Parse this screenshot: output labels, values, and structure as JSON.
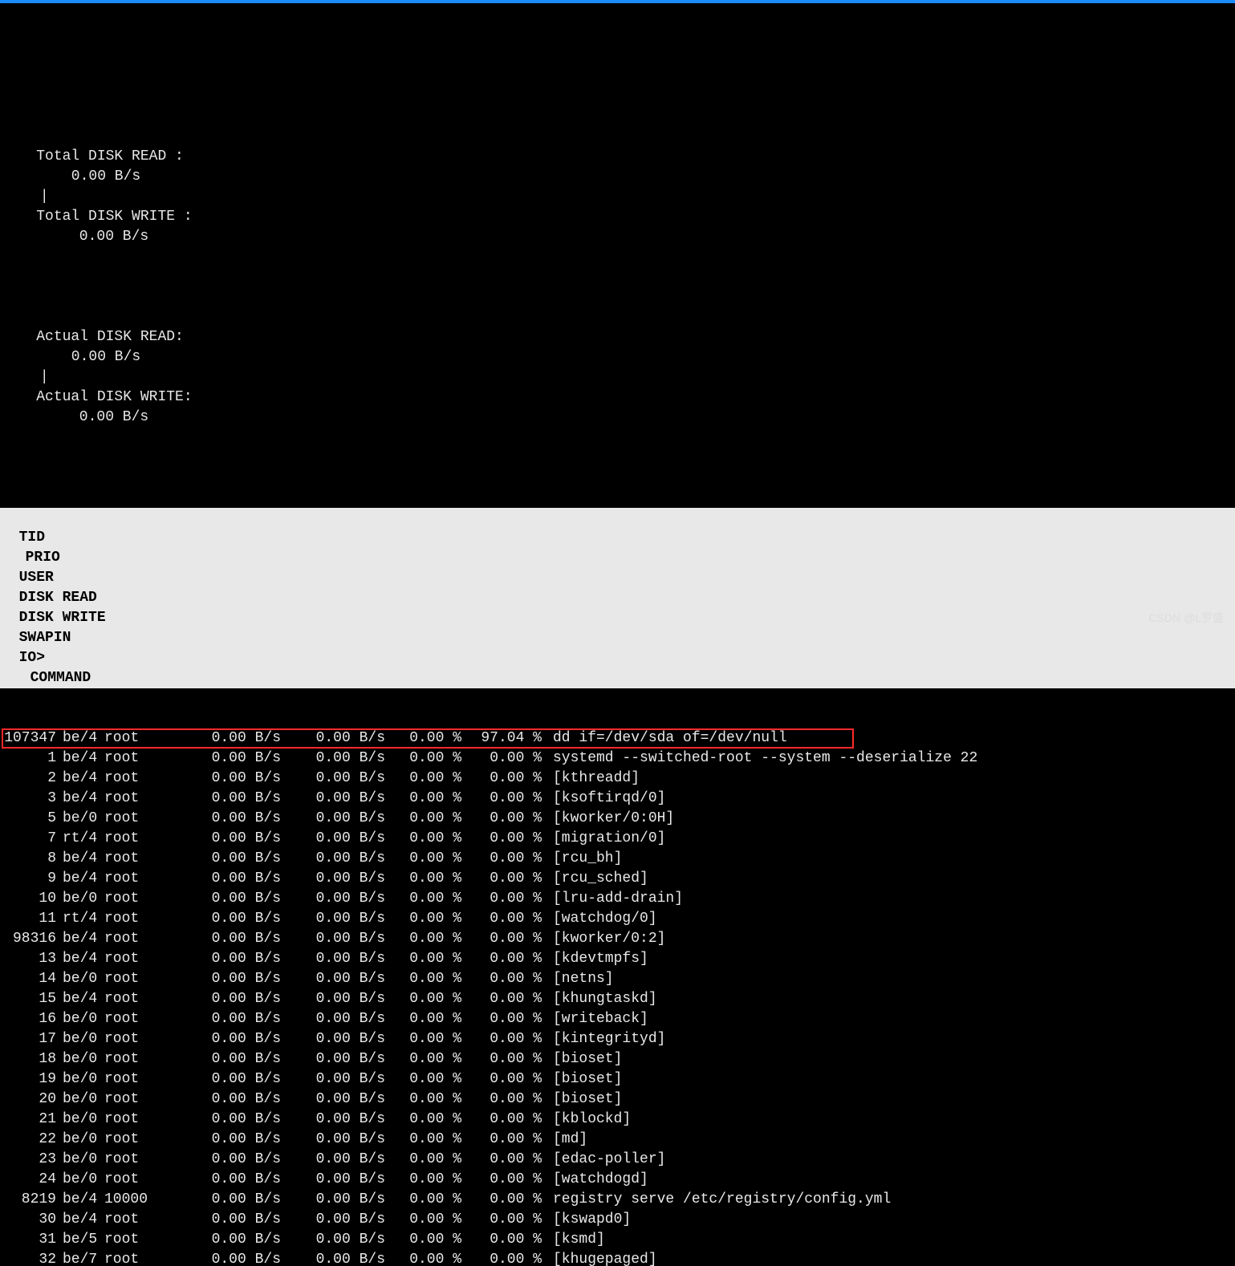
{
  "summary": {
    "total_read_label": "Total DISK READ :",
    "total_read_value": "0.00 B/s",
    "total_write_label": "Total DISK WRITE :",
    "total_write_value": "0.00 B/s",
    "actual_read_label": "Actual DISK READ:",
    "actual_read_value": "0.00 B/s",
    "actual_write_label": "Actual DISK WRITE:",
    "actual_write_value": "0.00 B/s",
    "separator": "|"
  },
  "columns": {
    "tid": "TID",
    "prio": "PRIO",
    "user": "USER",
    "dr": "DISK READ",
    "dw": "DISK WRITE",
    "swapin": "SWAPIN",
    "io": "IO>",
    "cmd": "COMMAND"
  },
  "rows": [
    {
      "tid": "107347",
      "prio": "be/4",
      "user": "root",
      "dr": "0.00 B/s",
      "dw": "0.00 B/s",
      "sw": "0.00 %",
      "io": "97.04 %",
      "cmd": "dd if=/dev/sda of=/dev/null",
      "hl": true
    },
    {
      "tid": "1",
      "prio": "be/4",
      "user": "root",
      "dr": "0.00 B/s",
      "dw": "0.00 B/s",
      "sw": "0.00 %",
      "io": "0.00 %",
      "cmd": "systemd --switched-root --system --deserialize 22"
    },
    {
      "tid": "2",
      "prio": "be/4",
      "user": "root",
      "dr": "0.00 B/s",
      "dw": "0.00 B/s",
      "sw": "0.00 %",
      "io": "0.00 %",
      "cmd": "[kthreadd]"
    },
    {
      "tid": "3",
      "prio": "be/4",
      "user": "root",
      "dr": "0.00 B/s",
      "dw": "0.00 B/s",
      "sw": "0.00 %",
      "io": "0.00 %",
      "cmd": "[ksoftirqd/0]"
    },
    {
      "tid": "5",
      "prio": "be/0",
      "user": "root",
      "dr": "0.00 B/s",
      "dw": "0.00 B/s",
      "sw": "0.00 %",
      "io": "0.00 %",
      "cmd": "[kworker/0:0H]"
    },
    {
      "tid": "7",
      "prio": "rt/4",
      "user": "root",
      "dr": "0.00 B/s",
      "dw": "0.00 B/s",
      "sw": "0.00 %",
      "io": "0.00 %",
      "cmd": "[migration/0]"
    },
    {
      "tid": "8",
      "prio": "be/4",
      "user": "root",
      "dr": "0.00 B/s",
      "dw": "0.00 B/s",
      "sw": "0.00 %",
      "io": "0.00 %",
      "cmd": "[rcu_bh]"
    },
    {
      "tid": "9",
      "prio": "be/4",
      "user": "root",
      "dr": "0.00 B/s",
      "dw": "0.00 B/s",
      "sw": "0.00 %",
      "io": "0.00 %",
      "cmd": "[rcu_sched]"
    },
    {
      "tid": "10",
      "prio": "be/0",
      "user": "root",
      "dr": "0.00 B/s",
      "dw": "0.00 B/s",
      "sw": "0.00 %",
      "io": "0.00 %",
      "cmd": "[lru-add-drain]"
    },
    {
      "tid": "11",
      "prio": "rt/4",
      "user": "root",
      "dr": "0.00 B/s",
      "dw": "0.00 B/s",
      "sw": "0.00 %",
      "io": "0.00 %",
      "cmd": "[watchdog/0]"
    },
    {
      "tid": "98316",
      "prio": "be/4",
      "user": "root",
      "dr": "0.00 B/s",
      "dw": "0.00 B/s",
      "sw": "0.00 %",
      "io": "0.00 %",
      "cmd": "[kworker/0:2]"
    },
    {
      "tid": "13",
      "prio": "be/4",
      "user": "root",
      "dr": "0.00 B/s",
      "dw": "0.00 B/s",
      "sw": "0.00 %",
      "io": "0.00 %",
      "cmd": "[kdevtmpfs]"
    },
    {
      "tid": "14",
      "prio": "be/0",
      "user": "root",
      "dr": "0.00 B/s",
      "dw": "0.00 B/s",
      "sw": "0.00 %",
      "io": "0.00 %",
      "cmd": "[netns]"
    },
    {
      "tid": "15",
      "prio": "be/4",
      "user": "root",
      "dr": "0.00 B/s",
      "dw": "0.00 B/s",
      "sw": "0.00 %",
      "io": "0.00 %",
      "cmd": "[khungtaskd]"
    },
    {
      "tid": "16",
      "prio": "be/0",
      "user": "root",
      "dr": "0.00 B/s",
      "dw": "0.00 B/s",
      "sw": "0.00 %",
      "io": "0.00 %",
      "cmd": "[writeback]"
    },
    {
      "tid": "17",
      "prio": "be/0",
      "user": "root",
      "dr": "0.00 B/s",
      "dw": "0.00 B/s",
      "sw": "0.00 %",
      "io": "0.00 %",
      "cmd": "[kintegrityd]"
    },
    {
      "tid": "18",
      "prio": "be/0",
      "user": "root",
      "dr": "0.00 B/s",
      "dw": "0.00 B/s",
      "sw": "0.00 %",
      "io": "0.00 %",
      "cmd": "[bioset]"
    },
    {
      "tid": "19",
      "prio": "be/0",
      "user": "root",
      "dr": "0.00 B/s",
      "dw": "0.00 B/s",
      "sw": "0.00 %",
      "io": "0.00 %",
      "cmd": "[bioset]"
    },
    {
      "tid": "20",
      "prio": "be/0",
      "user": "root",
      "dr": "0.00 B/s",
      "dw": "0.00 B/s",
      "sw": "0.00 %",
      "io": "0.00 %",
      "cmd": "[bioset]"
    },
    {
      "tid": "21",
      "prio": "be/0",
      "user": "root",
      "dr": "0.00 B/s",
      "dw": "0.00 B/s",
      "sw": "0.00 %",
      "io": "0.00 %",
      "cmd": "[kblockd]"
    },
    {
      "tid": "22",
      "prio": "be/0",
      "user": "root",
      "dr": "0.00 B/s",
      "dw": "0.00 B/s",
      "sw": "0.00 %",
      "io": "0.00 %",
      "cmd": "[md]"
    },
    {
      "tid": "23",
      "prio": "be/0",
      "user": "root",
      "dr": "0.00 B/s",
      "dw": "0.00 B/s",
      "sw": "0.00 %",
      "io": "0.00 %",
      "cmd": "[edac-poller]"
    },
    {
      "tid": "24",
      "prio": "be/0",
      "user": "root",
      "dr": "0.00 B/s",
      "dw": "0.00 B/s",
      "sw": "0.00 %",
      "io": "0.00 %",
      "cmd": "[watchdogd]"
    },
    {
      "tid": "8219",
      "prio": "be/4",
      "user": "10000",
      "dr": "0.00 B/s",
      "dw": "0.00 B/s",
      "sw": "0.00 %",
      "io": "0.00 %",
      "cmd": "registry serve /etc/registry/config.yml"
    },
    {
      "tid": "30",
      "prio": "be/4",
      "user": "root",
      "dr": "0.00 B/s",
      "dw": "0.00 B/s",
      "sw": "0.00 %",
      "io": "0.00 %",
      "cmd": "[kswapd0]"
    },
    {
      "tid": "31",
      "prio": "be/5",
      "user": "root",
      "dr": "0.00 B/s",
      "dw": "0.00 B/s",
      "sw": "0.00 %",
      "io": "0.00 %",
      "cmd": "[ksmd]"
    },
    {
      "tid": "32",
      "prio": "be/7",
      "user": "root",
      "dr": "0.00 B/s",
      "dw": "0.00 B/s",
      "sw": "0.00 %",
      "io": "0.00 %",
      "cmd": "[khugepaged]"
    }
  ],
  "watermark": "CSDN @L罗盛"
}
